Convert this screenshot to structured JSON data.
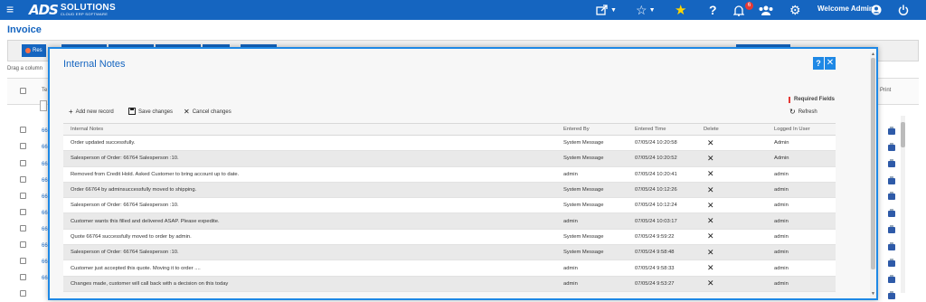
{
  "topbar": {
    "menu_icon": "hamburger-icon",
    "logo_mark": "ADS",
    "logo_text": "SOLUTIONS",
    "logo_tagline": "CLOUD ERP SOFTWARE",
    "icons": [
      "share-icon",
      "star-outline-icon",
      "star-filled-icon",
      "help-icon",
      "bell-icon",
      "users-icon",
      "gear-icon",
      "power-icon"
    ],
    "notification_count": "6",
    "welcome_text": "Welcome Admin",
    "accent_color": "#1565c0",
    "star_color": "#ffd600"
  },
  "page": {
    "title": "Invoice",
    "reset_label": "Res",
    "drag_hint": "Drag a column",
    "te_header": "Te",
    "print_header": "Print",
    "row_links": [
      "66",
      "66",
      "66",
      "66",
      "66",
      "66",
      "66",
      "66",
      "66",
      "66"
    ]
  },
  "modal": {
    "title": "Internal Notes",
    "help_label": "?",
    "close_label": "✕",
    "required_fields": "Required Fields",
    "toolbar": {
      "add_label": "Add new record",
      "save_label": "Save changes",
      "cancel_label": "Cancel changes",
      "refresh_label": "Refresh"
    },
    "columns": [
      "Internal Notes",
      "Entered By",
      "Entered Time",
      "Delete",
      "Logged In User"
    ],
    "rows": [
      {
        "note": "Order updated successfully.",
        "by": "System Message",
        "time": "07/05/24 10:20:58",
        "user": "Admin"
      },
      {
        "note": "Salesperson of Order: 66764 Salesperson :10.",
        "by": "System Message",
        "time": "07/05/24 10:20:52",
        "user": "Admin"
      },
      {
        "note": "Removed from Credit Hold. Asked Customer to bring account up to date.",
        "by": "admin",
        "time": "07/05/24 10:20:41",
        "user": "admin"
      },
      {
        "note": "Order 66764 by adminsuccessfully moved to shipping.",
        "by": "System Message",
        "time": "07/05/24 10:12:26",
        "user": "admin"
      },
      {
        "note": "Salesperson of Order: 66764 Salesperson :10.",
        "by": "System Message",
        "time": "07/05/24 10:12:24",
        "user": "admin"
      },
      {
        "note": "Customer wants this filled and delivered ASAP. Please expedite.",
        "by": "admin",
        "time": "07/05/24 10:03:17",
        "user": "admin"
      },
      {
        "note": "Quote 66764 successfully moved to order by admin.",
        "by": "System Message",
        "time": "07/05/24 9:59:22",
        "user": "admin"
      },
      {
        "note": "Salesperson of Order: 66764 Salesperson :10.",
        "by": "System Message",
        "time": "07/05/24 9:58:48",
        "user": "admin"
      },
      {
        "note": "Customer just accepted this quote. Moving it to order ....",
        "by": "admin",
        "time": "07/05/24 9:58:33",
        "user": "admin"
      },
      {
        "note": "Changes made, customer will call back with a decision on this today",
        "by": "admin",
        "time": "07/05/24 9:53:27",
        "user": "admin"
      }
    ]
  }
}
